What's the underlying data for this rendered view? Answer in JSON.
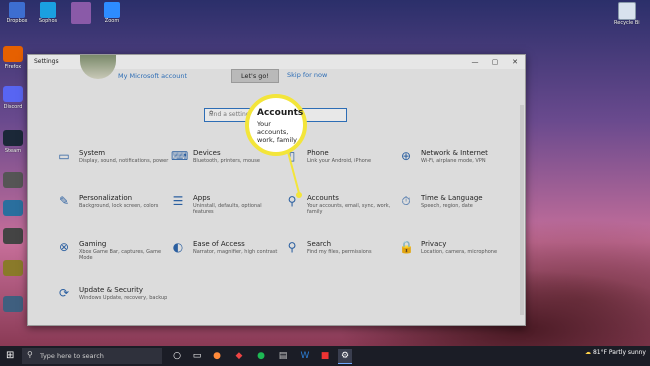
{
  "desktop": {
    "top_icons": [
      {
        "label": "Dropbox",
        "color": "#3d6ed0"
      },
      {
        "label": "Sophos",
        "color": "#1aa0e0"
      },
      {
        "label": "",
        "color": "#8a5aa8"
      },
      {
        "label": "Zoom",
        "color": "#2d8cff"
      }
    ],
    "left_icons": [
      {
        "label": "Firefox",
        "color": "#e66000"
      },
      {
        "label": "Discord",
        "color": "#5865f2"
      },
      {
        "label": "Steam",
        "color": "#1b2838"
      },
      {
        "label": "",
        "color": "#555555"
      },
      {
        "label": "",
        "color": "#2a6f9e"
      },
      {
        "label": "",
        "color": "#444444"
      },
      {
        "label": "",
        "color": "#8a7a2a"
      },
      {
        "label": "",
        "color": "#3f5f7f"
      }
    ],
    "recycle_bin": "Recycle Bin"
  },
  "window": {
    "title": "Settings",
    "controls": [
      "—",
      "▢",
      "✕"
    ],
    "account_email": "",
    "account_link": "My Microsoft account",
    "lets_go": "Let's go!",
    "skip": "Skip for now",
    "search_placeholder": "Find a setting",
    "categories": [
      {
        "name": "System",
        "desc": "Display, sound, notifications, power",
        "icon": "laptop-icon",
        "glyph": "▭"
      },
      {
        "name": "Devices",
        "desc": "Bluetooth, printers, mouse",
        "icon": "keyboard-icon",
        "glyph": "⌨"
      },
      {
        "name": "Phone",
        "desc": "Link your Android, iPhone",
        "icon": "phone-icon",
        "glyph": "▯"
      },
      {
        "name": "Network & Internet",
        "desc": "Wi-Fi, airplane mode, VPN",
        "icon": "globe-icon",
        "glyph": "⊕"
      },
      {
        "name": "Personalization",
        "desc": "Background, lock screen, colors",
        "icon": "paintbrush-icon",
        "glyph": "✎"
      },
      {
        "name": "Apps",
        "desc": "Uninstall, defaults, optional features",
        "icon": "apps-list-icon",
        "glyph": "☰"
      },
      {
        "name": "Accounts",
        "desc": "Your accounts, email, sync, work, family",
        "icon": "person-icon",
        "glyph": "⚲"
      },
      {
        "name": "Time & Language",
        "desc": "Speech, region, date",
        "icon": "clock-language-icon",
        "glyph": "⏱"
      },
      {
        "name": "Gaming",
        "desc": "Xbox Game Bar, captures, Game Mode",
        "icon": "xbox-icon",
        "glyph": "⊗"
      },
      {
        "name": "Ease of Access",
        "desc": "Narrator, magnifier, high contrast",
        "icon": "accessibility-icon",
        "glyph": "◐"
      },
      {
        "name": "Search",
        "desc": "Find my files, permissions",
        "icon": "search-icon",
        "glyph": "⚲"
      },
      {
        "name": "Privacy",
        "desc": "Location, camera, microphone",
        "icon": "lock-icon",
        "glyph": "🔒"
      },
      {
        "name": "Update & Security",
        "desc": "Windows Update, recovery, backup",
        "icon": "sync-icon",
        "glyph": "⟳"
      }
    ]
  },
  "callout": {
    "title": "Accounts",
    "body": "Your accounts, work, family",
    "border_color": "#f3e53a"
  },
  "taskbar": {
    "search_placeholder": "Type here to search",
    "weather": "81°F  Partly sunny",
    "time": "",
    "date": ""
  }
}
